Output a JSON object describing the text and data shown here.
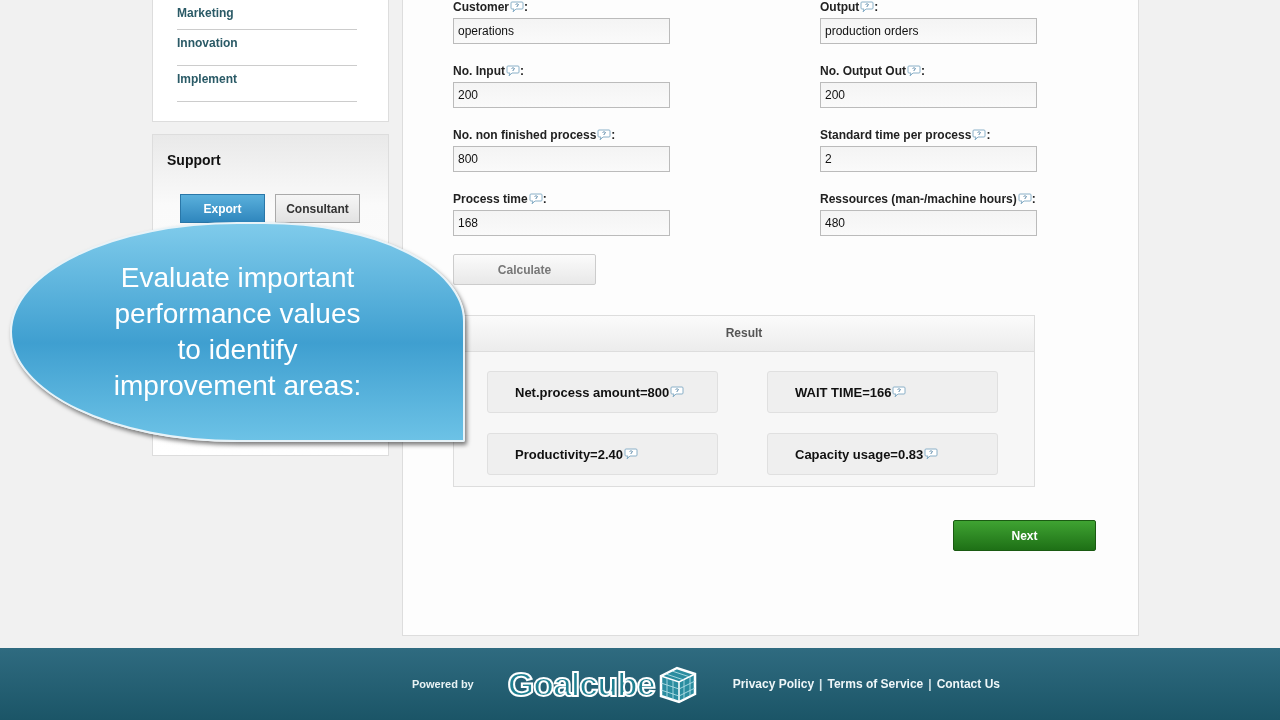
{
  "sidebar": {
    "menu": [
      {
        "label": "Marketing"
      },
      {
        "label": "Innovation"
      },
      {
        "label": "Implement"
      }
    ],
    "support": {
      "title": "Support",
      "buttons": [
        {
          "label": "Export",
          "selected": true
        },
        {
          "label": "Consultant",
          "selected": false
        }
      ]
    }
  },
  "form": {
    "fields": [
      {
        "label": "Customer",
        "suffix": ":",
        "value": "operations"
      },
      {
        "label": "Output",
        "suffix": ":",
        "value": "production orders"
      },
      {
        "label": "No. Input",
        "suffix": ":",
        "value": "200"
      },
      {
        "label": "No. Output Out",
        "suffix": ":",
        "value": "200"
      },
      {
        "label": "No. non finished process",
        "suffix": ":",
        "value": "800"
      },
      {
        "label": "Standard time per process",
        "suffix": ":",
        "value": "2"
      },
      {
        "label": "Process time",
        "suffix": ":",
        "value": "168"
      },
      {
        "label": "Ressources (man-/machine hours)",
        "suffix": ":",
        "value": "480"
      }
    ],
    "calculate_button": "Calculate",
    "result": {
      "title": "Result",
      "items": [
        "Net.process amount=800",
        "WAIT TIME=166",
        "Productivity=2.40",
        "Capacity usage=0.83"
      ]
    },
    "next_button": "Next"
  },
  "callout": "Evaluate important performance values to identify improvement areas:",
  "footer": {
    "powered_by": "Powered by",
    "logo": "Goalcube",
    "links": [
      {
        "kind": "link",
        "text": "Privacy Policy"
      },
      {
        "kind": "separator",
        "text": "|"
      },
      {
        "kind": "link",
        "text": "Terms of Service"
      },
      {
        "kind": "separator",
        "text": "|"
      },
      {
        "kind": "link",
        "text": "Contact Us"
      }
    ]
  }
}
